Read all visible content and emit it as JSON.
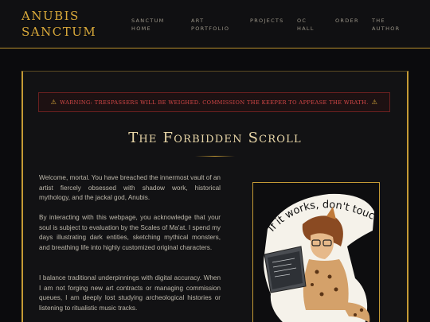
{
  "header": {
    "logo_line1": "ANUBIS",
    "logo_line2": "SANCTUM",
    "nav": [
      {
        "label": "SANCTUM\nHOME"
      },
      {
        "label": "ART\nPORTFOLIO"
      },
      {
        "label": "PROJECTS"
      },
      {
        "label": "OC\nHALL"
      },
      {
        "label": "ORDER"
      },
      {
        "label": "THE\nAUTHOR"
      }
    ]
  },
  "warning": {
    "icon": "⚠",
    "text": "WARNING: TRESPASSERS WILL BE WEIGHED. COMMISSION THE KEEPER TO APPEASE THE WRATH."
  },
  "main": {
    "title": "The Forbidden Scroll",
    "paragraphs": [
      "Welcome, mortal. You have breached the innermost vault of an artist fiercely obsessed with shadow work, historical mythology, and the jackal god, Anubis.",
      "By interacting with this webpage, you acknowledge that your soul is subject to evaluation by the Scales of Ma'at. I spend my days illustrating dark entities, sketching mythical monsters, and breathing life into highly customized original characters.",
      "I balance traditional underpinnings with digital accuracy. When I am not forging new art contracts or managing commission queues, I am deeply lost studying archeological histories or listening to ritualistic music tracks."
    ],
    "art": {
      "sticker_text": "If it works, don't touch it"
    }
  },
  "colors": {
    "gold": "#c49a35",
    "warning_red": "#d84848",
    "background": "#0b0b0d"
  }
}
